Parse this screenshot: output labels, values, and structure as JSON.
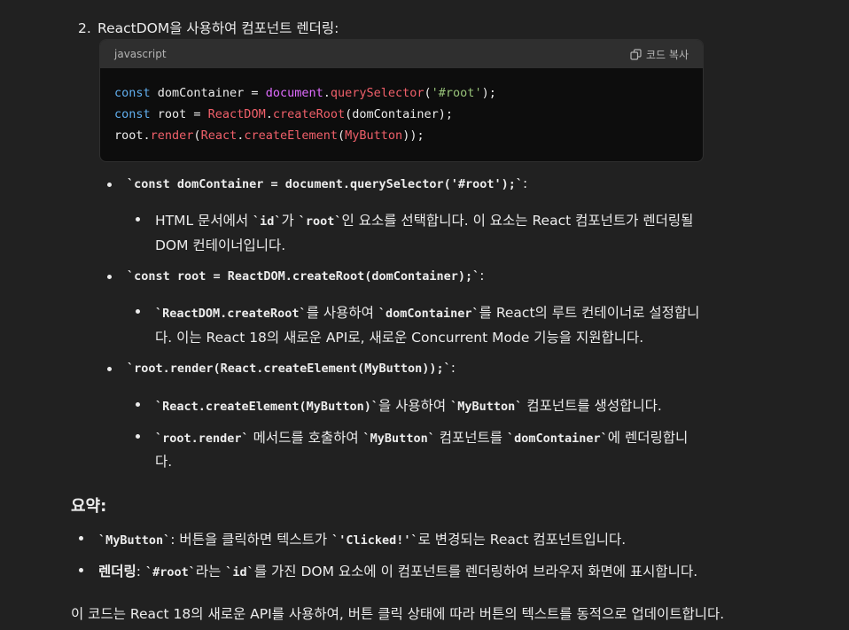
{
  "step": {
    "number": "2.",
    "title": "ReactDOM을 사용하여 컴포넌트 렌더링:"
  },
  "code": {
    "language": "javascript",
    "copy_label": "코드 복사",
    "lines": [
      [
        [
          "kw",
          "const"
        ],
        [
          "txt",
          " domContainer = "
        ],
        [
          "obj",
          "document"
        ],
        [
          "txt",
          "."
        ],
        [
          "fn",
          "querySelector"
        ],
        [
          "txt",
          "("
        ],
        [
          "str",
          "'#root'"
        ],
        [
          "txt",
          ");"
        ]
      ],
      [
        [
          "kw",
          "const"
        ],
        [
          "txt",
          " root = "
        ],
        [
          "cls",
          "ReactDOM"
        ],
        [
          "txt",
          "."
        ],
        [
          "fn",
          "createRoot"
        ],
        [
          "txt",
          "(domContainer);"
        ]
      ],
      [
        [
          "txt",
          "root."
        ],
        [
          "fn",
          "render"
        ],
        [
          "txt",
          "("
        ],
        [
          "cls",
          "React"
        ],
        [
          "txt",
          "."
        ],
        [
          "fn",
          "createElement"
        ],
        [
          "txt",
          "("
        ],
        [
          "cls",
          "MyButton"
        ],
        [
          "txt",
          "));"
        ]
      ]
    ]
  },
  "bullets": {
    "b1": {
      "code": "`const domContainer = document.querySelector('#root');`",
      "suffix": ":"
    },
    "b1_sub": {
      "t1": "HTML 문서에서 ",
      "c1": "`id`",
      "t2": "가 ",
      "c2": "`root`",
      "t3": "인 요소를 선택합니다. 이 요소는 React 컴포넌트가 렌더링될",
      "line2": "DOM 컨테이너입니다."
    },
    "b2": {
      "code": "`const root = ReactDOM.createRoot(domContainer);`",
      "suffix": ":"
    },
    "b2_sub": {
      "c1": "`ReactDOM.createRoot`",
      "t1": "를 사용하여 ",
      "c2": "`domContainer`",
      "t2": "를 React의 루트 컨테이너로 설정합니",
      "line2": "다. 이는 React 18의 새로운 API로, 새로운 Concurrent Mode 기능을 지원합니다."
    },
    "b3": {
      "code": "`root.render(React.createElement(MyButton));`",
      "suffix": ":"
    },
    "b3_sub1": {
      "c1": "`React.createElement(MyButton)`",
      "t1": "을 사용하여 ",
      "c2": "`MyButton`",
      "t2": " 컴포넌트를 생성합니다."
    },
    "b3_sub2": {
      "c1": "`root.render`",
      "t1": " 메서드를 호출하여 ",
      "c2": "`MyButton`",
      "t2": " 컴포넌트를 ",
      "c3": "`domContainer`",
      "t3": "에 렌더링합니",
      "line2": "다."
    }
  },
  "summary": {
    "heading": "요약:",
    "s1": {
      "c1": "`MyButton`",
      "t1": ": 버튼을 클릭하면 텍스트가 ",
      "c2": "`'Clicked!'`",
      "t2": "로 변경되는 React 컴포넌트입니다."
    },
    "s2": {
      "b1": "렌더링",
      "t1": ": ",
      "c1": "`#root`",
      "t2": "라는 ",
      "c2": "`id`",
      "t3": "를 가진 DOM 요소에 이 컴포넌트를 렌더링하여 브라우저 화면에 표시합니다."
    },
    "closing": "이 코드는 React 18의 새로운 API를 사용하여, 버튼 클릭 상태에 따라 버튼의 텍스트를 동적으로 업데이트합니다."
  }
}
